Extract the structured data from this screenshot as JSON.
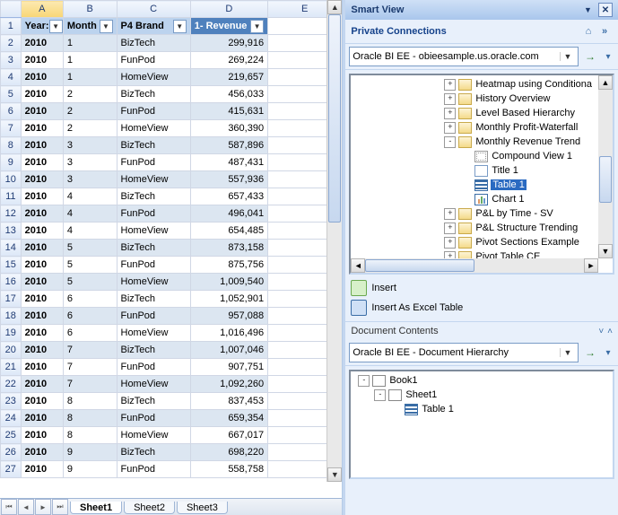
{
  "spreadsheet": {
    "columns": [
      "A",
      "B",
      "C",
      "D",
      "E"
    ],
    "selected_column": "A",
    "header_row": {
      "a": "Year:",
      "b": "Month",
      "c": "P4 Brand",
      "d": "1- Revenue"
    },
    "rows": [
      {
        "n": 2,
        "year": "2010",
        "month": "1",
        "brand": "BizTech",
        "rev": "299,916"
      },
      {
        "n": 3,
        "year": "2010",
        "month": "1",
        "brand": "FunPod",
        "rev": "269,224"
      },
      {
        "n": 4,
        "year": "2010",
        "month": "1",
        "brand": "HomeView",
        "rev": "219,657"
      },
      {
        "n": 5,
        "year": "2010",
        "month": "2",
        "brand": "BizTech",
        "rev": "456,033"
      },
      {
        "n": 6,
        "year": "2010",
        "month": "2",
        "brand": "FunPod",
        "rev": "415,631"
      },
      {
        "n": 7,
        "year": "2010",
        "month": "2",
        "brand": "HomeView",
        "rev": "360,390"
      },
      {
        "n": 8,
        "year": "2010",
        "month": "3",
        "brand": "BizTech",
        "rev": "587,896"
      },
      {
        "n": 9,
        "year": "2010",
        "month": "3",
        "brand": "FunPod",
        "rev": "487,431"
      },
      {
        "n": 10,
        "year": "2010",
        "month": "3",
        "brand": "HomeView",
        "rev": "557,936"
      },
      {
        "n": 11,
        "year": "2010",
        "month": "4",
        "brand": "BizTech",
        "rev": "657,433"
      },
      {
        "n": 12,
        "year": "2010",
        "month": "4",
        "brand": "FunPod",
        "rev": "496,041"
      },
      {
        "n": 13,
        "year": "2010",
        "month": "4",
        "brand": "HomeView",
        "rev": "654,485"
      },
      {
        "n": 14,
        "year": "2010",
        "month": "5",
        "brand": "BizTech",
        "rev": "873,158"
      },
      {
        "n": 15,
        "year": "2010",
        "month": "5",
        "brand": "FunPod",
        "rev": "875,756"
      },
      {
        "n": 16,
        "year": "2010",
        "month": "5",
        "brand": "HomeView",
        "rev": "1,009,540"
      },
      {
        "n": 17,
        "year": "2010",
        "month": "6",
        "brand": "BizTech",
        "rev": "1,052,901"
      },
      {
        "n": 18,
        "year": "2010",
        "month": "6",
        "brand": "FunPod",
        "rev": "957,088"
      },
      {
        "n": 19,
        "year": "2010",
        "month": "6",
        "brand": "HomeView",
        "rev": "1,016,496"
      },
      {
        "n": 20,
        "year": "2010",
        "month": "7",
        "brand": "BizTech",
        "rev": "1,007,046"
      },
      {
        "n": 21,
        "year": "2010",
        "month": "7",
        "brand": "FunPod",
        "rev": "907,751"
      },
      {
        "n": 22,
        "year": "2010",
        "month": "7",
        "brand": "HomeView",
        "rev": "1,092,260"
      },
      {
        "n": 23,
        "year": "2010",
        "month": "8",
        "brand": "BizTech",
        "rev": "837,453"
      },
      {
        "n": 24,
        "year": "2010",
        "month": "8",
        "brand": "FunPod",
        "rev": "659,354"
      },
      {
        "n": 25,
        "year": "2010",
        "month": "8",
        "brand": "HomeView",
        "rev": "667,017"
      },
      {
        "n": 26,
        "year": "2010",
        "month": "9",
        "brand": "BizTech",
        "rev": "698,220"
      },
      {
        "n": 27,
        "year": "2010",
        "month": "9",
        "brand": "FunPod",
        "rev": "558,758"
      }
    ],
    "tabs": {
      "active": "Sheet1",
      "others": [
        "Sheet2",
        "Sheet3"
      ]
    }
  },
  "panel": {
    "title": "Smart View",
    "section": "Private Connections",
    "connection": "Oracle BI EE - obieesample.us.oracle.com",
    "tree": [
      {
        "depth": 0,
        "exp": "+",
        "icon": "report",
        "label": "Heatmap using Conditiona"
      },
      {
        "depth": 0,
        "exp": "+",
        "icon": "report",
        "label": "History Overview"
      },
      {
        "depth": 0,
        "exp": "+",
        "icon": "report",
        "label": "Level Based Hierarchy"
      },
      {
        "depth": 0,
        "exp": "+",
        "icon": "report",
        "label": "Monthly Profit-Waterfall"
      },
      {
        "depth": 0,
        "exp": "-",
        "icon": "report",
        "label": "Monthly Revenue Trend"
      },
      {
        "depth": 1,
        "exp": "",
        "icon": "compound",
        "label": "Compound View 1"
      },
      {
        "depth": 1,
        "exp": "",
        "icon": "title",
        "label": "Title 1"
      },
      {
        "depth": 1,
        "exp": "",
        "icon": "table",
        "label": "Table 1",
        "selected": true
      },
      {
        "depth": 1,
        "exp": "",
        "icon": "chart",
        "label": "Chart 1"
      },
      {
        "depth": 0,
        "exp": "+",
        "icon": "report",
        "label": "P&L by Time - SV"
      },
      {
        "depth": 0,
        "exp": "+",
        "icon": "report",
        "label": "P&L Structure Trending"
      },
      {
        "depth": 0,
        "exp": "+",
        "icon": "report",
        "label": "Pivot Sections Example"
      },
      {
        "depth": 0,
        "exp": "+",
        "icon": "report",
        "label": "Pivot Table CE"
      }
    ],
    "actions": {
      "insert": "Insert",
      "insert_table": "Insert As Excel Table"
    },
    "doc_section": "Document Contents",
    "doc_dropdown": "Oracle BI EE - Document Hierarchy",
    "doc_tree": [
      {
        "depth": 0,
        "exp": "-",
        "icon": "book",
        "label": "Book1"
      },
      {
        "depth": 1,
        "exp": "-",
        "icon": "sheet",
        "label": "Sheet1"
      },
      {
        "depth": 2,
        "exp": "",
        "icon": "table",
        "label": "Table 1"
      }
    ]
  }
}
